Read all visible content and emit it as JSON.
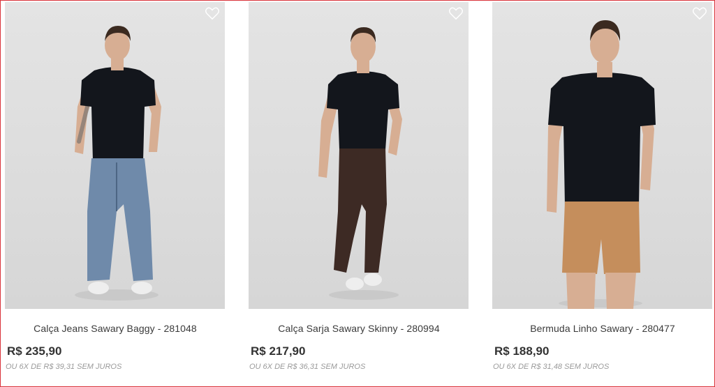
{
  "products": [
    {
      "name": "Calça Jeans Sawary Baggy - 281048",
      "price": "R$ 235,90",
      "installments": "OU 6X DE R$ 39,31 SEM JUROS",
      "image_icon": "model-baggy-jeans-image",
      "shirt_color": "#13161c",
      "bottom_color": "#6f8aaa",
      "bottom_type": "pants"
    },
    {
      "name": "Calça Sarja Sawary Skinny - 280994",
      "price": "R$ 217,90",
      "installments": "OU 6X DE R$ 36,31 SEM JUROS",
      "image_icon": "model-skinny-chino-image",
      "shirt_color": "#13161c",
      "bottom_color": "#3d2a24",
      "bottom_type": "pants"
    },
    {
      "name": "Bermuda Linho Sawary - 280477",
      "price": "R$ 188,90",
      "installments": "OU 6X DE R$ 31,48 SEM JUROS",
      "image_icon": "model-linen-shorts-image",
      "shirt_color": "#13161c",
      "bottom_color": "#c58e5c",
      "bottom_type": "shorts"
    }
  ],
  "colors": {
    "border_accent": "#d9333a",
    "heart_icon": "#ffffff",
    "skin": "#d7ae93",
    "hair": "#3b2a20",
    "shoe": "#eeeeee"
  },
  "icons": {
    "favorite": "heart-outline-icon"
  }
}
